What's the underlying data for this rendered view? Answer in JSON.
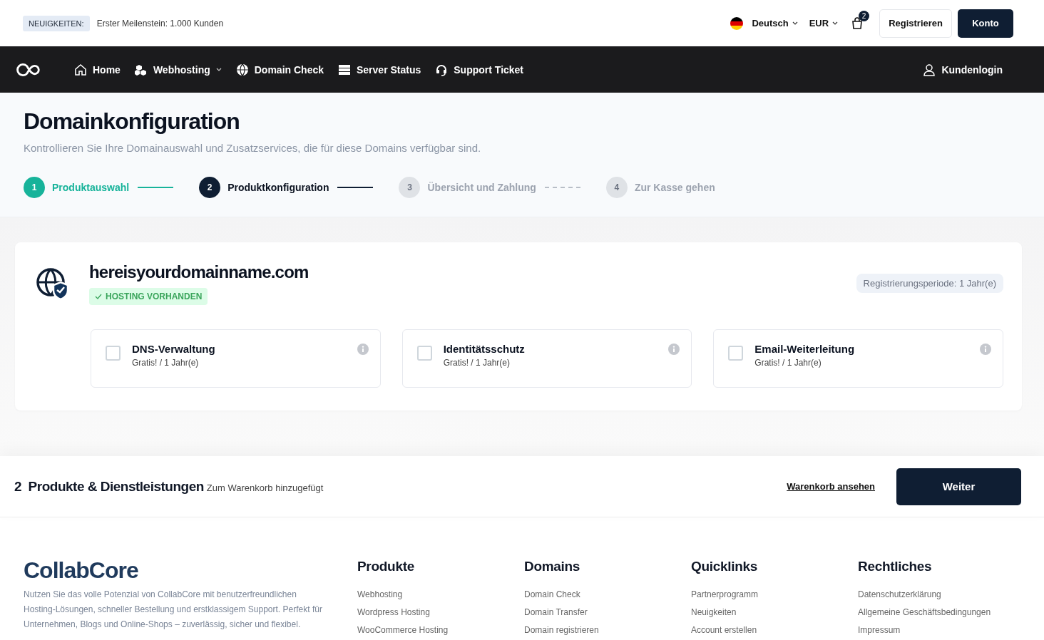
{
  "news": {
    "badge": "NEUIGKEITEN:",
    "text": "Erster Meilenstein: 1.000 Kunden"
  },
  "topbar": {
    "language": "Deutsch",
    "currency": "EUR",
    "cart_count": "2",
    "register": "Registrieren",
    "account": "Konto"
  },
  "nav": {
    "items": [
      {
        "label": "Home",
        "dropdown": false
      },
      {
        "label": "Webhosting",
        "dropdown": true
      },
      {
        "label": "Domain Check",
        "dropdown": false
      },
      {
        "label": "Server Status",
        "dropdown": false
      },
      {
        "label": "Support Ticket",
        "dropdown": false
      }
    ],
    "login": "Kundenlogin"
  },
  "page": {
    "title": "Domainkonfiguration",
    "subtitle": "Kontrollieren Sie Ihre Domainauswahl und Zusatzservices, die für diese Domains verfügbar sind."
  },
  "steps": [
    {
      "number": "1",
      "label": "Produktauswahl",
      "kind": "done"
    },
    {
      "number": "2",
      "label": "Produktkonfiguration",
      "kind": "current"
    },
    {
      "number": "3",
      "label": "Übersicht und Zahlung",
      "kind": "upcoming"
    },
    {
      "number": "4",
      "label": "Zur Kasse gehen",
      "kind": "upcoming"
    }
  ],
  "domain": {
    "name": "hereisyourdomainname.com",
    "badge": "HOSTING VORHANDEN",
    "period": "Registrierungsperiode: 1 Jahr(e)",
    "addons": [
      {
        "name": "DNS-Verwaltung",
        "price": "Gratis! / 1 Jahr(e)",
        "checked": false
      },
      {
        "name": "Identitätsschutz",
        "price": "Gratis! / 1 Jahr(e)",
        "checked": false
      },
      {
        "name": "Email-Weiterleitung",
        "price": "Gratis! / 1 Jahr(e)",
        "checked": false
      }
    ]
  },
  "summary": {
    "count": "2",
    "title": "Produkte & Dienstleistungen",
    "note": "Zum Warenkorb hinzugefügt",
    "link": "Warenkorb ansehen",
    "button": "Weiter"
  },
  "footer": {
    "brand": "CollabCore",
    "about": "Nutzen Sie das volle Potenzial von CollabCore mit benutzerfreundlichen Hosting-Lösungen, schneller Bestellung und erstklassigem Support. Perfekt für Unternehmen, Blogs und Online-Shops – zuverlässig, sicher und flexibel.",
    "columns": [
      {
        "title": "Produkte",
        "links": [
          "Webhosting",
          "Wordpress Hosting",
          "WooCommerce Hosting"
        ]
      },
      {
        "title": "Domains",
        "links": [
          "Domain Check",
          "Domain Transfer",
          "Domain registrieren"
        ]
      },
      {
        "title": "Quicklinks",
        "links": [
          "Partnerprogramm",
          "Neuigkeiten",
          "Account erstellen"
        ]
      },
      {
        "title": "Rechtliches",
        "links": [
          "Datenschutzerklärung",
          "Allgemeine Geschäftsbedingungen",
          "Impressum"
        ]
      }
    ]
  }
}
